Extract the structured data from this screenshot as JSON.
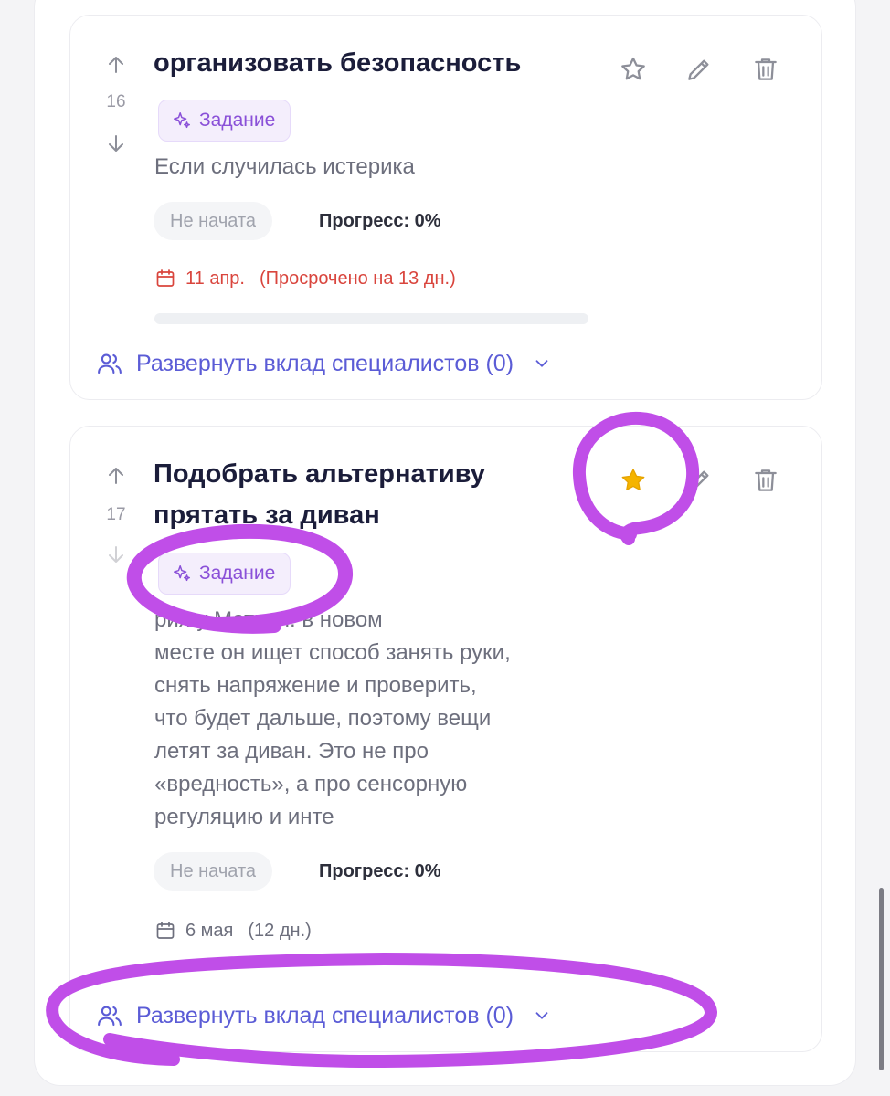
{
  "tasks": [
    {
      "number": "16",
      "title": "организовать безопасность",
      "tag": "Задание",
      "description": "Если случилась истерика",
      "status": "Не начата",
      "progress": "Прогресс: 0%",
      "progress_fraction": 0,
      "date": "11 апр.",
      "date_note": "(Просрочено на 13 дн.)",
      "date_color": "#d9453d",
      "starred": false,
      "expand_label": "Развернуть вклад специалистов (0)"
    },
    {
      "number": "17",
      "title": "Подобрать альтернативу прятать за диван",
      "title_line1": "Подобрать альтернативу",
      "title_line2": "прятать за диван",
      "tag": "Задание",
      "description": "рия у Матвея: в новом\nместе он ищет способ занять руки,\nснять напряжение и проверить,\nчто будет дальше, поэтому вещи\nлетят за диван. Это не про\n«вредность», а про сенсорную\nрегуляцию и инте",
      "status": "Не начата",
      "progress": "Прогресс: 0%",
      "progress_fraction": 0,
      "date": "6 мая",
      "date_note": "(12 дн.)",
      "date_color": "#6d6f7d",
      "starred": true,
      "expand_label": "Развернуть вклад специалистов (0)"
    }
  ],
  "colors": {
    "accent": "#5b5cd6",
    "tag": "#8a50d8",
    "star_active": "#f5b400",
    "annotation": "#c04ee8",
    "overdue": "#d9453d"
  },
  "icons": {
    "up": "arrow-up-icon",
    "down": "arrow-down-icon",
    "star": "star-icon",
    "edit": "pencil-icon",
    "delete": "trash-icon",
    "tag": "sparkle-icon",
    "calendar": "calendar-icon",
    "people": "users-icon",
    "chevron": "chevron-down-icon"
  }
}
